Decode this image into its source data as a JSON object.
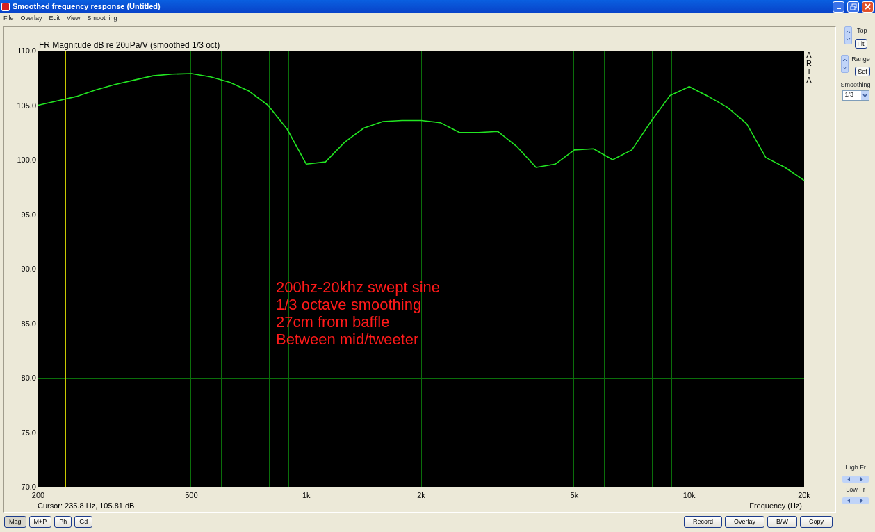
{
  "window": {
    "title": "Smoothed frequency response (Untitled)"
  },
  "menu": [
    "File",
    "Overlay",
    "Edit",
    "View",
    "Smoothing"
  ],
  "chart": {
    "cursor_readout": "Cursor: 235.8 Hz, 105.81 dB",
    "side_mark": "ARTA",
    "chart_data": {
      "type": "line",
      "title": "FR Magnitude dB re 20uPa/V (smoothed 1/3 oct)",
      "xlabel": "Frequency (Hz)",
      "categories": [
        "200",
        null,
        null,
        null,
        null,
        null,
        null,
        null,
        "500",
        null,
        null,
        null,
        null,
        null,
        "1k",
        null,
        null,
        null,
        null,
        null,
        "2k",
        null,
        null,
        null,
        null,
        null,
        null,
        null,
        "5k",
        null,
        null,
        null,
        null,
        null,
        "10k",
        null,
        null,
        null,
        null,
        null,
        "20k"
      ],
      "series": [
        {
          "color": "#22e622",
          "values": [
            105.0,
            105.4,
            105.8,
            106.4,
            106.9,
            107.3,
            107.7,
            107.85,
            107.9,
            107.6,
            107.1,
            106.3,
            105.0,
            102.8,
            99.6,
            99.8,
            101.6,
            102.9,
            103.5,
            103.6,
            103.6,
            103.4,
            102.5,
            102.5,
            102.6,
            101.2,
            99.3,
            99.6,
            100.9,
            101.0,
            100.0,
            100.9,
            103.5,
            105.9,
            106.7,
            105.8,
            104.8,
            103.3,
            100.2,
            99.3,
            98.1
          ]
        }
      ],
      "ylim": [
        70,
        110
      ],
      "yticks": [
        {
          "value": 70,
          "label": "70.0"
        },
        {
          "value": 75,
          "label": "75.0"
        },
        {
          "value": 80,
          "label": "80.0"
        },
        {
          "value": 85,
          "label": "85.0"
        },
        {
          "value": 90,
          "label": "90.0"
        },
        {
          "value": 95,
          "label": "95.0"
        },
        {
          "value": 100,
          "label": "100.0"
        },
        {
          "value": 105,
          "label": "105.0"
        },
        {
          "value": 110,
          "label": "110.0"
        }
      ],
      "grid": true,
      "annotations": [
        "200hz-20khz swept sine",
        "1/3 octave smoothing",
        "27cm from baffle",
        "Between mid/tweeter"
      ]
    }
  },
  "side_panel": {
    "top_label": "Top",
    "fit_button": "Fit",
    "range_label": "Range",
    "set_button": "Set",
    "smoothing_label": "Smoothing",
    "smoothing_value": "1/3",
    "high_fr_label": "High Fr",
    "low_fr_label": "Low Fr"
  },
  "view_buttons": [
    {
      "label": "Mag",
      "selected": true
    },
    {
      "label": "M+P",
      "selected": false
    },
    {
      "label": "Ph",
      "selected": false
    },
    {
      "label": "Gd",
      "selected": false
    }
  ],
  "action_buttons": [
    "Record",
    "Overlay",
    "B/W",
    "Copy"
  ]
}
